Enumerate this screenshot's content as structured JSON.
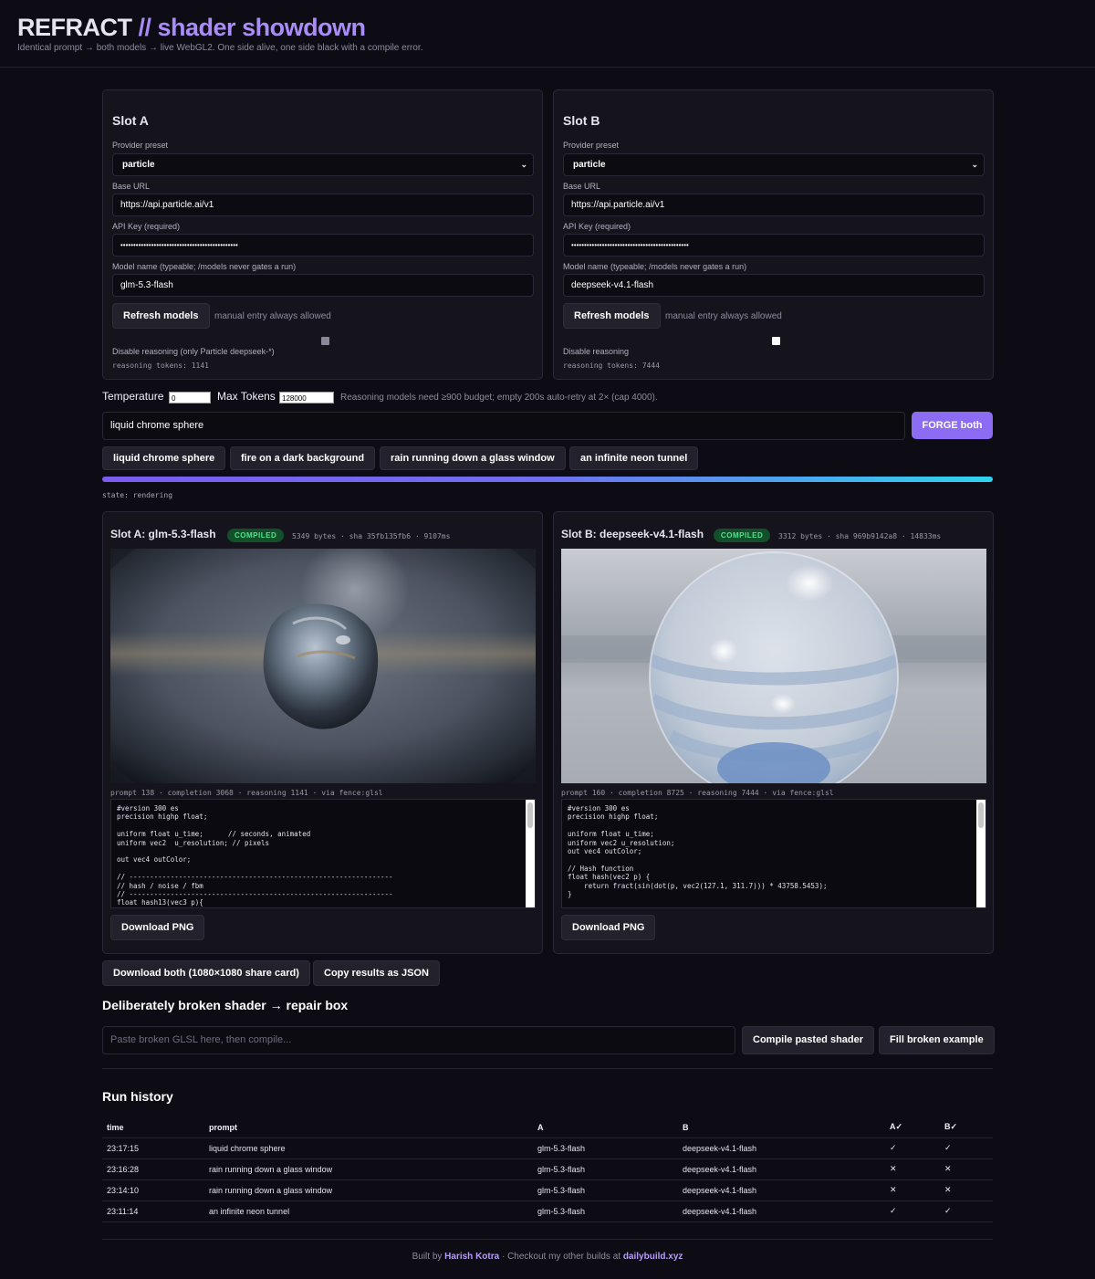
{
  "header": {
    "title_main": "REFRACT",
    "title_accent": "// shader showdown",
    "subtitle": "Identical prompt → both models → live WebGL2. One side alive, one side black with a compile error."
  },
  "slot_a": {
    "title": "Slot A",
    "preset_label": "Provider preset",
    "preset_value": "particle",
    "base_url_label": "Base URL",
    "base_url": "https://api.particle.ai/v1",
    "api_key_label": "API Key (required)",
    "api_key": "••••••••••••••••••••••••••••••••••••••••••••••",
    "model_label": "Model name (typeable; /models never gates a run)",
    "model": "glm-5.3-flash",
    "refresh_label": "Refresh models",
    "refresh_hint": "manual entry always allowed",
    "reasoning_toggle_label": "Disable reasoning (only Particle deepseek-*)",
    "reasoning_tokens": "reasoning tokens: 1141"
  },
  "slot_b": {
    "title": "Slot B",
    "preset_label": "Provider preset",
    "preset_value": "particle",
    "base_url_label": "Base URL",
    "base_url": "https://api.particle.ai/v1",
    "api_key_label": "API Key (required)",
    "api_key": "••••••••••••••••••••••••••••••••••••••••••••••",
    "model_label": "Model name (typeable; /models never gates a run)",
    "model": "deepseek-v4.1-flash",
    "refresh_label": "Refresh models",
    "refresh_hint": "manual entry always allowed",
    "reasoning_toggle_label": "Disable reasoning",
    "reasoning_tokens": "reasoning tokens: 7444"
  },
  "controls": {
    "temperature_label": "Temperature",
    "temperature": "0",
    "max_tokens_label": "Max Tokens",
    "max_tokens": "128000",
    "hint": "Reasoning models need ≥900 budget; empty 200s auto-retry at 2× (cap 4000).",
    "prompt": "liquid chrome sphere",
    "forge_label": "FORGE both",
    "presets": [
      "liquid chrome sphere",
      "fire on a dark background",
      "rain running down a glass window",
      "an infinite neon tunnel"
    ],
    "progress": 1.0,
    "state": "state: rendering"
  },
  "result_a": {
    "title": "Slot A: glm-5.3-flash",
    "badge": "COMPILED",
    "meta": "5349 bytes · sha 35fb135fb6 · 9107ms",
    "usage": "prompt 138 · completion 3068 · reasoning 1141 · via fence:glsl",
    "code": "#version 300 es\nprecision highp float;\n\nuniform float u_time;      // seconds, animated\nuniform vec2  u_resolution; // pixels\n\nout vec4 outColor;\n\n// ----------------------------------------------------------------\n// hash / noise / fbm\n// ----------------------------------------------------------------\nfloat hash13(vec3 p){",
    "download_label": "Download PNG"
  },
  "result_b": {
    "title": "Slot B: deepseek-v4.1-flash",
    "badge": "COMPILED",
    "meta": "3312 bytes · sha 969b9142a8 · 14833ms",
    "usage": "prompt 160 · completion 8725 · reasoning 7444 · via fence:glsl",
    "code": "#version 300 es\nprecision highp float;\n\nuniform float u_time;\nuniform vec2 u_resolution;\nout vec4 outColor;\n\n// Hash function\nfloat hash(vec2 p) {\n    return fract(sin(dot(p, vec2(127.1, 311.7))) * 43758.5453);\n}",
    "download_label": "Download PNG"
  },
  "actions": {
    "download_both": "Download both (1080×1080 share card)",
    "copy_json": "Copy results as JSON"
  },
  "broken": {
    "title": "Deliberately broken shader → repair box",
    "placeholder": "Paste broken GLSL here, then compile...",
    "compile_label": "Compile pasted shader",
    "fill_label": "Fill broken example"
  },
  "history": {
    "title": "Run history",
    "columns": [
      "time",
      "prompt",
      "A",
      "B",
      "A✓",
      "B✓"
    ],
    "rows": [
      [
        "23:17:15",
        "liquid chrome sphere",
        "glm-5.3-flash",
        "deepseek-v4.1-flash",
        "✓",
        "✓"
      ],
      [
        "23:16:28",
        "rain running down a glass window",
        "glm-5.3-flash",
        "deepseek-v4.1-flash",
        "✕",
        "✕"
      ],
      [
        "23:14:10",
        "rain running down a glass window",
        "glm-5.3-flash",
        "deepseek-v4.1-flash",
        "✕",
        "✕"
      ],
      [
        "23:11:14",
        "an infinite neon tunnel",
        "glm-5.3-flash",
        "deepseek-v4.1-flash",
        "✓",
        "✓"
      ]
    ]
  },
  "footer": {
    "prefix": "Built by",
    "author": "Harish Kotra",
    "middle": "· Checkout my other builds at",
    "site": "dailybuild.xyz"
  },
  "colors": {
    "accent": "#a98cf6",
    "forge": "#8c6cf3",
    "compiled_bg": "#134f2b",
    "compiled_text": "#4fe38b",
    "progress_end": "#2fd3ef"
  }
}
